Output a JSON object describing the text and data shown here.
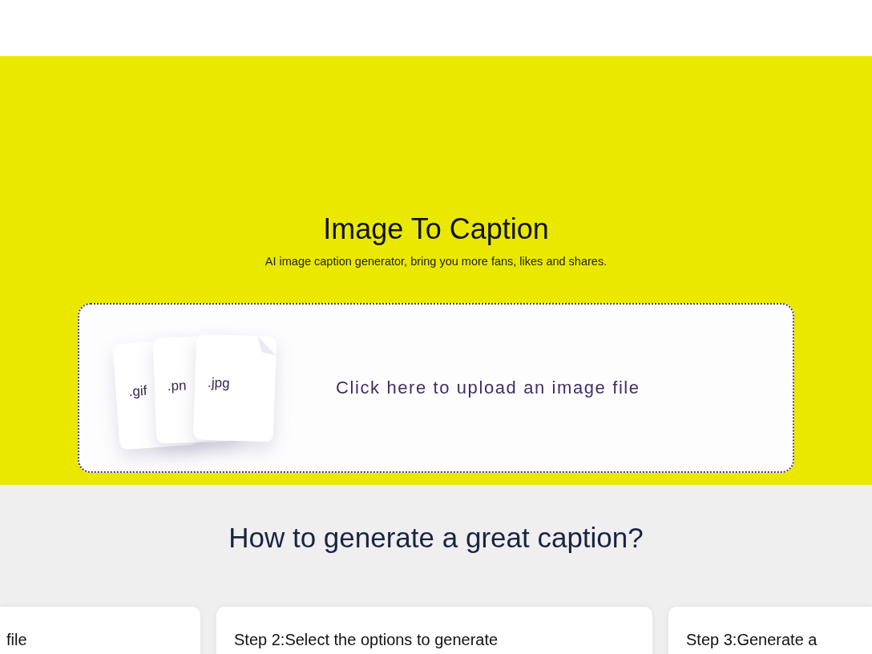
{
  "hero": {
    "title": "Image To Caption",
    "subtitle": "AI image caption generator, bring you more fans, likes and shares.",
    "upload": {
      "file_types": [
        ".gif",
        ".pn",
        ".jpg"
      ],
      "prompt": "Click here to upload an image file"
    }
  },
  "how_to": {
    "heading": "How to generate a great caption?",
    "steps": [
      {
        "text": "file"
      },
      {
        "text": "Step 2:Select the options to generate"
      },
      {
        "text": "Step 3:Generate a"
      }
    ]
  }
}
